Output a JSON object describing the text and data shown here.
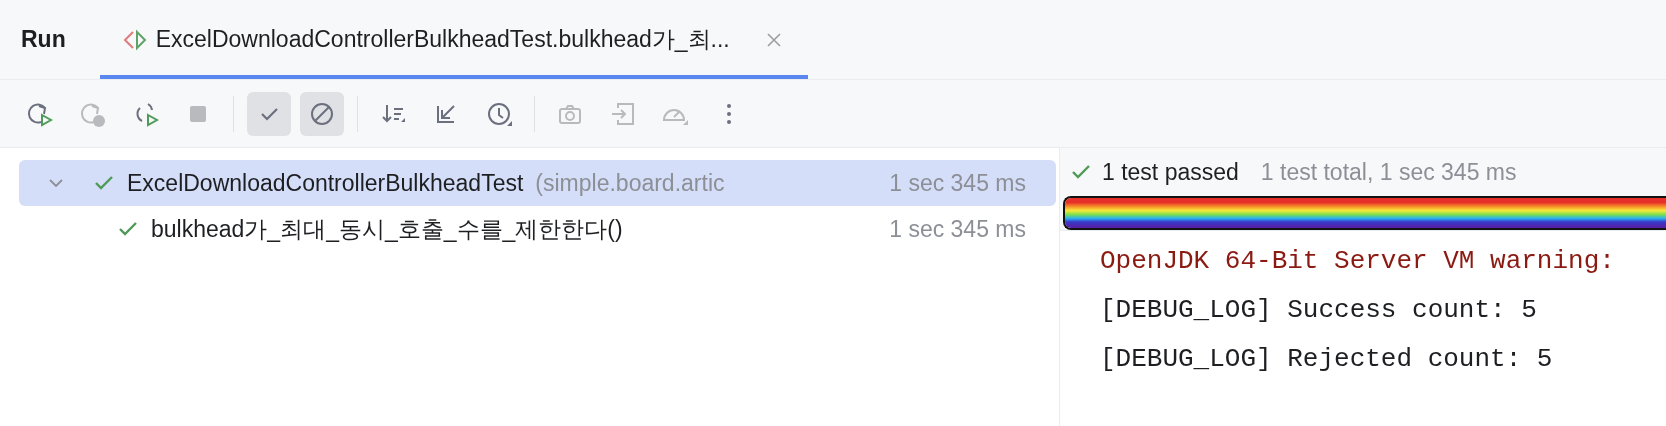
{
  "tool_window": {
    "title": "Run"
  },
  "tabs": [
    {
      "label": "ExcelDownloadControllerBulkheadTest.bulkhead가_최...",
      "selected": true
    }
  ],
  "toolbar": [
    {
      "kind": "rerun",
      "disabled": false,
      "selected": false
    },
    {
      "kind": "rerun-failed",
      "disabled": true,
      "selected": false
    },
    {
      "kind": "toggle-auto",
      "disabled": false,
      "selected": false
    },
    {
      "kind": "stop",
      "disabled": true,
      "selected": false
    },
    {
      "kind": "separator"
    },
    {
      "kind": "show-passed",
      "disabled": false,
      "selected": true
    },
    {
      "kind": "show-ignored",
      "disabled": false,
      "selected": true
    },
    {
      "kind": "separator"
    },
    {
      "kind": "sort",
      "disabled": false,
      "selected": false
    },
    {
      "kind": "collapse",
      "disabled": false,
      "selected": false
    },
    {
      "kind": "history",
      "disabled": false,
      "selected": false
    },
    {
      "kind": "separator"
    },
    {
      "kind": "screenshot",
      "disabled": true,
      "selected": false
    },
    {
      "kind": "import",
      "disabled": true,
      "selected": false
    },
    {
      "kind": "gauge",
      "disabled": true,
      "selected": false
    },
    {
      "kind": "more",
      "disabled": false,
      "selected": false
    }
  ],
  "tree": [
    {
      "name": "ExcelDownloadControllerBulkheadTest",
      "package": "(simple.board.artic",
      "duration": "1 sec 345 ms",
      "passed": true,
      "selected": true,
      "expanded": true,
      "children": [
        {
          "name": "bulkhead가_최대_동시_호출_수를_제한한다()",
          "duration": "1 sec 345 ms",
          "passed": true,
          "selected": false
        }
      ]
    }
  ],
  "summary": {
    "passed": true,
    "result": "1 test passed",
    "details": "1 test total, 1 sec 345 ms",
    "level": 1
  },
  "console": [
    {
      "kind": "stderr",
      "text": "OpenJDK 64-Bit Server VM warning:"
    },
    {
      "kind": "stdout",
      "text": "[DEBUG_LOG] Success count: 5"
    },
    {
      "kind": "stdout",
      "text": "[DEBUG_LOG] Rejected count: 5"
    }
  ]
}
